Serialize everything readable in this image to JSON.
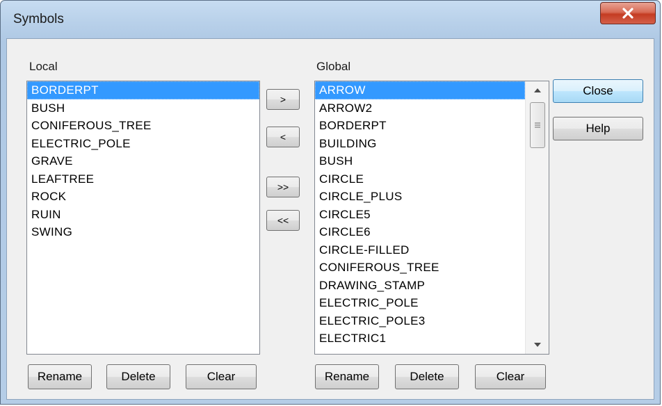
{
  "window": {
    "title": "Symbols"
  },
  "local": {
    "label": "Local",
    "items": [
      "BORDERPT",
      "BUSH",
      "CONIFEROUS_TREE",
      "ELECTRIC_POLE",
      "GRAVE",
      "LEAFTREE",
      "ROCK",
      "RUIN",
      "SWING"
    ],
    "selected_index": 0,
    "buttons": {
      "rename": "Rename",
      "delete": "Delete",
      "clear": "Clear"
    }
  },
  "transfer": {
    "add": ">",
    "remove": "<",
    "add_all": ">>",
    "remove_all": "<<"
  },
  "global": {
    "label": "Global",
    "items": [
      "ARROW",
      "ARROW2",
      "BORDERPT",
      "BUILDING",
      "BUSH",
      "CIRCLE",
      "CIRCLE_PLUS",
      "CIRCLE5",
      "CIRCLE6",
      "CIRCLE-FILLED",
      "CONIFEROUS_TREE",
      "DRAWING_STAMP",
      "ELECTRIC_POLE",
      "ELECTRIC_POLE3",
      "ELECTRIC1"
    ],
    "selected_index": 0,
    "buttons": {
      "rename": "Rename",
      "delete": "Delete",
      "clear": "Clear"
    }
  },
  "side_buttons": {
    "close": "Close",
    "help": "Help"
  },
  "icons": {
    "title_close": "close-icon",
    "scroll_up": "scroll-up-icon",
    "scroll_down": "scroll-down-icon",
    "thumb_grip": "grip-icon"
  },
  "colors": {
    "selection": "#3399ff",
    "close_button": "#c43c22",
    "default_button_border": "#3c7fb1"
  }
}
